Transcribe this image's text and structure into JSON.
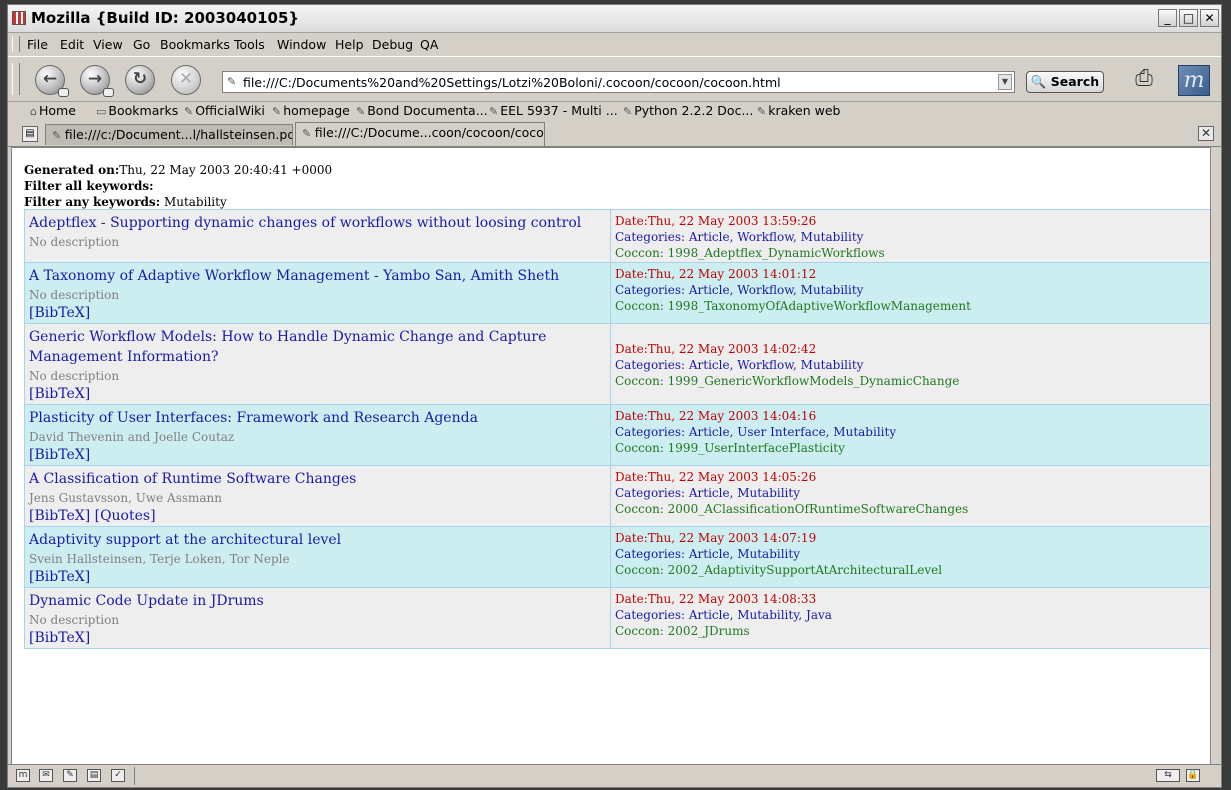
{
  "window": {
    "title": "Mozilla {Build ID: 2003040105}"
  },
  "menu": [
    "File",
    "Edit",
    "View",
    "Go",
    "Bookmarks",
    "Tools",
    "Window",
    "Help",
    "Debug",
    "QA"
  ],
  "nav": {
    "url": "file:///C:/Documents%20and%20Settings/Lotzi%20Boloni/.cocoon/cocoon/cocoon.html",
    "search_label": "Search"
  },
  "personal_toolbar": [
    "Home",
    "Bookmarks",
    "OfficialWiki",
    "homepage",
    "Bond Documenta...",
    "EEL 5937 - Multi ...",
    "Python 2.2.2 Doc...",
    "kraken web"
  ],
  "tabs": [
    {
      "label": "file:///c:/Document...l/hallsteinsen.pdf",
      "active": false
    },
    {
      "label": "file:///C:/Docume...coon/cocoon/cocoon.html",
      "active": true
    }
  ],
  "page": {
    "generated_label": "Generated on:",
    "generated_value": "Thu, 22 May 2003 20:40:41 +0000",
    "filter_all_label": "Filter all keywords:",
    "filter_all_value": "",
    "filter_any_label": "Filter any keywords:",
    "filter_any_value": " Mutability",
    "entries": [
      {
        "title": "Adeptflex - Supporting dynamic changes of workflows without loosing control",
        "desc": "No description",
        "links": "",
        "date": "Date:Thu, 22 May 2003 13:59:26",
        "categories": "Categories: Article, Workflow, Mutability",
        "coccon": "Coccon: 1998_Adeptflex_DynamicWorkflows"
      },
      {
        "title": "A Taxonomy of Adaptive Workflow Management - Yambo San, Amith Sheth",
        "desc": "No description",
        "links": "[BibTeX]",
        "date": "Date:Thu, 22 May 2003 14:01:12",
        "categories": "Categories: Article, Workflow, Mutability",
        "coccon": "Coccon: 1998_TaxonomyOfAdaptiveWorkflowManagement"
      },
      {
        "title": "Generic Workflow Models: How to Handle Dynamic Change and Capture Management Information?",
        "desc": "No description",
        "links": "[BibTeX]",
        "date": "Date:Thu, 22 May 2003 14:02:42",
        "categories": "Categories: Article, Workflow, Mutability",
        "coccon": "Coccon: 1999_GenericWorkflowModels_DynamicChange"
      },
      {
        "title": "Plasticity of User Interfaces: Framework and Research Agenda",
        "desc": "David Thevenin and Joelle Coutaz",
        "links": "[BibTeX]",
        "date": "Date:Thu, 22 May 2003 14:04:16",
        "categories": "Categories: Article, User Interface, Mutability",
        "coccon": "Coccon: 1999_UserInterfacePlasticity"
      },
      {
        "title": "A Classification of Runtime Software Changes",
        "desc": "Jens Gustavsson, Uwe Assmann",
        "links": "[BibTeX] [Quotes]",
        "date": "Date:Thu, 22 May 2003 14:05:26",
        "categories": "Categories: Article, Mutability",
        "coccon": "Coccon: 2000_AClassificationOfRuntimeSoftwareChanges"
      },
      {
        "title": "Adaptivity support at the architectural level",
        "desc": "Svein Hallsteinsen, Terje Loken, Tor Neple",
        "links": "[BibTeX]",
        "date": "Date:Thu, 22 May 2003 14:07:19",
        "categories": "Categories: Article, Mutability",
        "coccon": "Coccon: 2002_AdaptivitySupportAtArchitecturalLevel"
      },
      {
        "title": "Dynamic Code Update in JDrums",
        "desc": "No description",
        "links": "[BibTeX]",
        "date": "Date:Thu, 22 May 2003 14:08:33",
        "categories": "Categories: Article, Mutability, Java",
        "coccon": "Coccon: 2002_JDrums"
      }
    ]
  }
}
